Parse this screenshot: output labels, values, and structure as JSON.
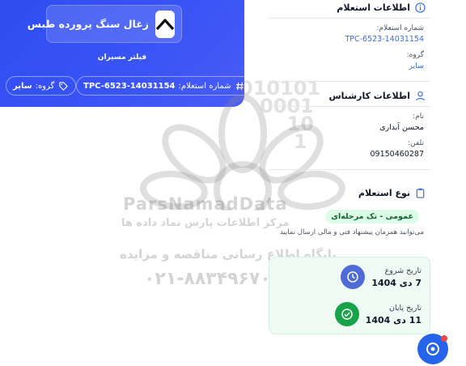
{
  "hero": {
    "company_name": "زغال سنگ پرورده طبس",
    "subtitle": "فیلتر مسیران",
    "tpc_label": "شماره استعلام:",
    "tpc_value": "TPC-6523-14031154",
    "group_label": "گروه:",
    "group_value": "سایر"
  },
  "inquiry_info": {
    "title": "اطلاعات استعلام",
    "number_label": "شماره استعلام:",
    "number_value": "TPC-6523-14031154",
    "group_label": "گروه:",
    "group_value": "سایر"
  },
  "expert_info": {
    "title": "اطلاعات کارشناس",
    "name_label": "نام:",
    "name_value": "محسن آبداری",
    "phone_label": "تلفن:",
    "phone_value": "09150460287"
  },
  "inquiry_type": {
    "title": "نوع استعلام",
    "badge": "عمومی - تک مرحله‌ای",
    "description": "می‌توانید همزمان پیشنهاد فنی و مالی ارسال نمایید"
  },
  "dates": {
    "start_label": "تاریخ شروع",
    "start_value": "7 دی 1404",
    "end_label": "تاریخ پایان",
    "end_value": "11 دی 1404"
  },
  "watermark": {
    "brand": "ParsNamadData",
    "line1": "مرکز اطلاعات پارس نماد داده ها",
    "line2": "پایگاه اطلاع رسانی مناقصه و مزایده",
    "phone": "۰۲۱-۸۸۳۴۹۶۷۰-۵",
    "binary": "010101\n0001\n10\n1"
  },
  "colors": {
    "hero_blue": "#3a54f5",
    "link_blue": "#3b6fd8",
    "badge_green_bg": "#dcfce7",
    "start_icon": "#4f6bd8",
    "end_icon": "#16a34a"
  }
}
